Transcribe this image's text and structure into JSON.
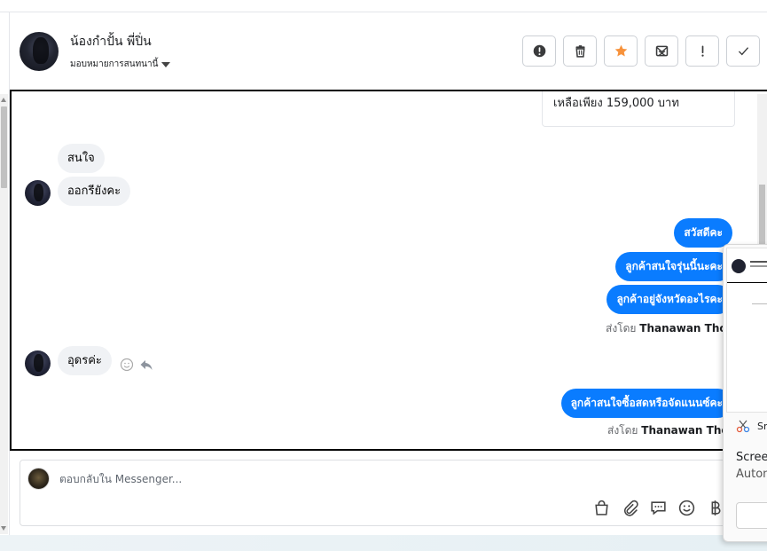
{
  "header": {
    "contact_name": "น้องกำปั้น พี่ปิ่น",
    "assign_label": "มอบหมายการสนทนานี้"
  },
  "actions": [
    {
      "name": "report-spam-button",
      "icon": "exclamation-circle-icon"
    },
    {
      "name": "delete-button",
      "icon": "trash-icon"
    },
    {
      "name": "star-button",
      "icon": "star-icon",
      "color": "#f7923b"
    },
    {
      "name": "mark-unread-button",
      "icon": "envelope-x-icon"
    },
    {
      "name": "important-button",
      "icon": "exclamation-icon"
    },
    {
      "name": "done-button",
      "icon": "check-icon"
    }
  ],
  "conversation": {
    "quote_text": "เหลือเพียง 159,000 บาท",
    "messages": [
      {
        "dir": "in",
        "text": "สนใจ"
      },
      {
        "dir": "in",
        "text": "ออกรียังคะ"
      },
      {
        "dir": "out",
        "text": "สวัสดีคะ"
      },
      {
        "dir": "out",
        "text": "ลูกค้าสนใจรุ่นนี้นะคะ"
      },
      {
        "dir": "out",
        "text": "ลูกค้าอยู่จังหวัดอะไรคะ"
      },
      {
        "dir": "in",
        "text": "อุดรค่ะ"
      },
      {
        "dir": "out",
        "text": "ลูกค้าสนใจซื้อสดหรือจัดแนนซ์คะ"
      }
    ],
    "sent_by_prefix": "ส่งโดย",
    "sent_by_name": "Thanawan Thon"
  },
  "composer": {
    "placeholder": "ตอบกลับใน Messenger..."
  },
  "popup": {
    "app_name": "Sn",
    "title": "Screen",
    "subtitle": "Autom"
  },
  "colors": {
    "accent": "#0a7cff",
    "incoming_bubble": "#f0f2f5",
    "star": "#f7923b"
  }
}
